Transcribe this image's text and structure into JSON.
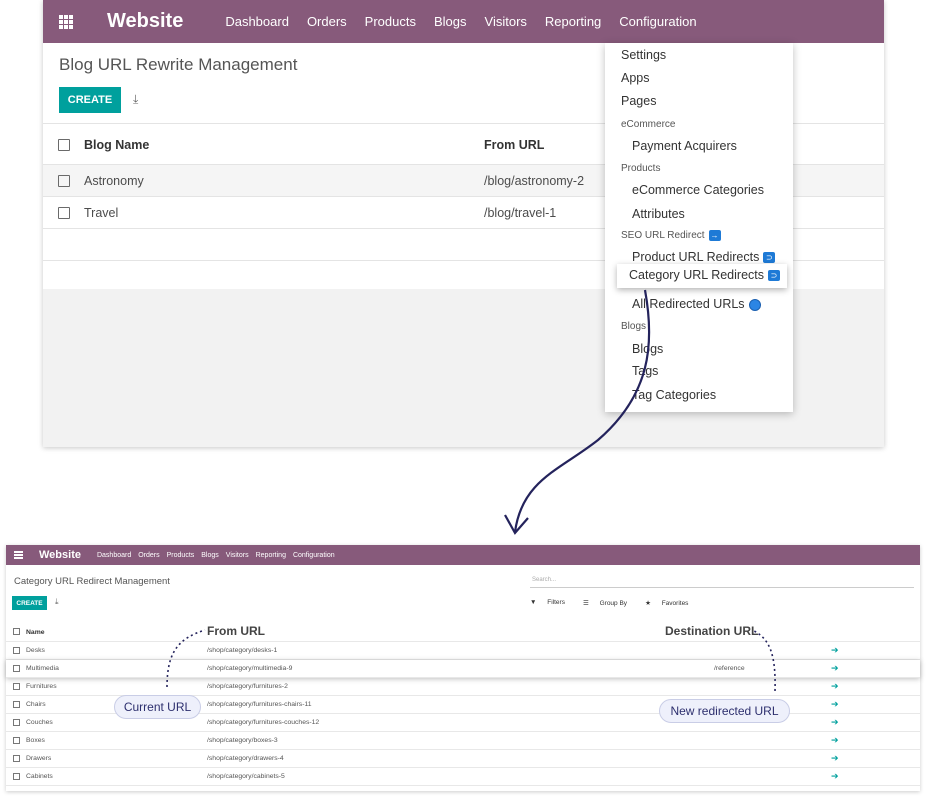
{
  "top": {
    "app_name": "Website",
    "menu": [
      "Dashboard",
      "Orders",
      "Products",
      "Blogs",
      "Visitors",
      "Reporting",
      "Configuration"
    ],
    "page_title": "Blog URL Rewrite Management",
    "create_label": "CREATE",
    "columns": [
      "Blog Name",
      "From URL"
    ],
    "rows": [
      {
        "name": "Astronomy",
        "from": "/blog/astronomy-2"
      },
      {
        "name": "Travel",
        "from": "/blog/travel-1"
      }
    ],
    "dropdown": {
      "settings": "Settings",
      "apps": "Apps",
      "pages": "Pages",
      "ecommerce_header": "eCommerce",
      "payment_acquirers": "Payment Acquirers",
      "products_header": "Products",
      "ecommerce_categories": "eCommerce Categories",
      "attributes": "Attributes",
      "seo_header": "SEO URL Redirect",
      "product_redirects": "Product URL Redirects",
      "category_redirects": "Category URL Redirects",
      "all_redirected": "All Redirected URLs",
      "blogs_header": "Blogs",
      "blogs": "Blogs",
      "tags": "Tags",
      "tag_categories": "Tag Categories"
    }
  },
  "bottom": {
    "app_name": "Website",
    "menu": [
      "Dashboard",
      "Orders",
      "Products",
      "Blogs",
      "Visitors",
      "Reporting",
      "Configuration"
    ],
    "page_title": "Category URL Redirect Management",
    "search_placeholder": "Search...",
    "create_label": "CREATE",
    "filters": "Filters",
    "group_by": "Group By",
    "favorites": "Favorites",
    "name_header": "Name",
    "from_header": "From URL",
    "dest_header": "Destination URL",
    "rows": [
      {
        "name": "Desks",
        "from": "/shop/category/desks-1",
        "dest": ""
      },
      {
        "name": "Multimedia",
        "from": "/shop/category/multimedia-9",
        "dest": "/reference"
      },
      {
        "name": "Furnitures",
        "from": "/shop/category/furnitures-2",
        "dest": ""
      },
      {
        "name": "Chairs",
        "from": "/shop/category/furnitures-chairs-11",
        "dest": ""
      },
      {
        "name": "Couches",
        "from": "/shop/category/furnitures-couches-12",
        "dest": ""
      },
      {
        "name": "Boxes",
        "from": "/shop/category/boxes-3",
        "dest": ""
      },
      {
        "name": "Drawers",
        "from": "/shop/category/drawers-4",
        "dest": ""
      },
      {
        "name": "Cabinets",
        "from": "/shop/category/cabinets-5",
        "dest": ""
      }
    ]
  },
  "callouts": {
    "current": "Current URL",
    "redirected": "New redirected URL"
  },
  "colors": {
    "brand": "#875a7b",
    "accent": "#00a09d",
    "arrow": "#24235c"
  }
}
